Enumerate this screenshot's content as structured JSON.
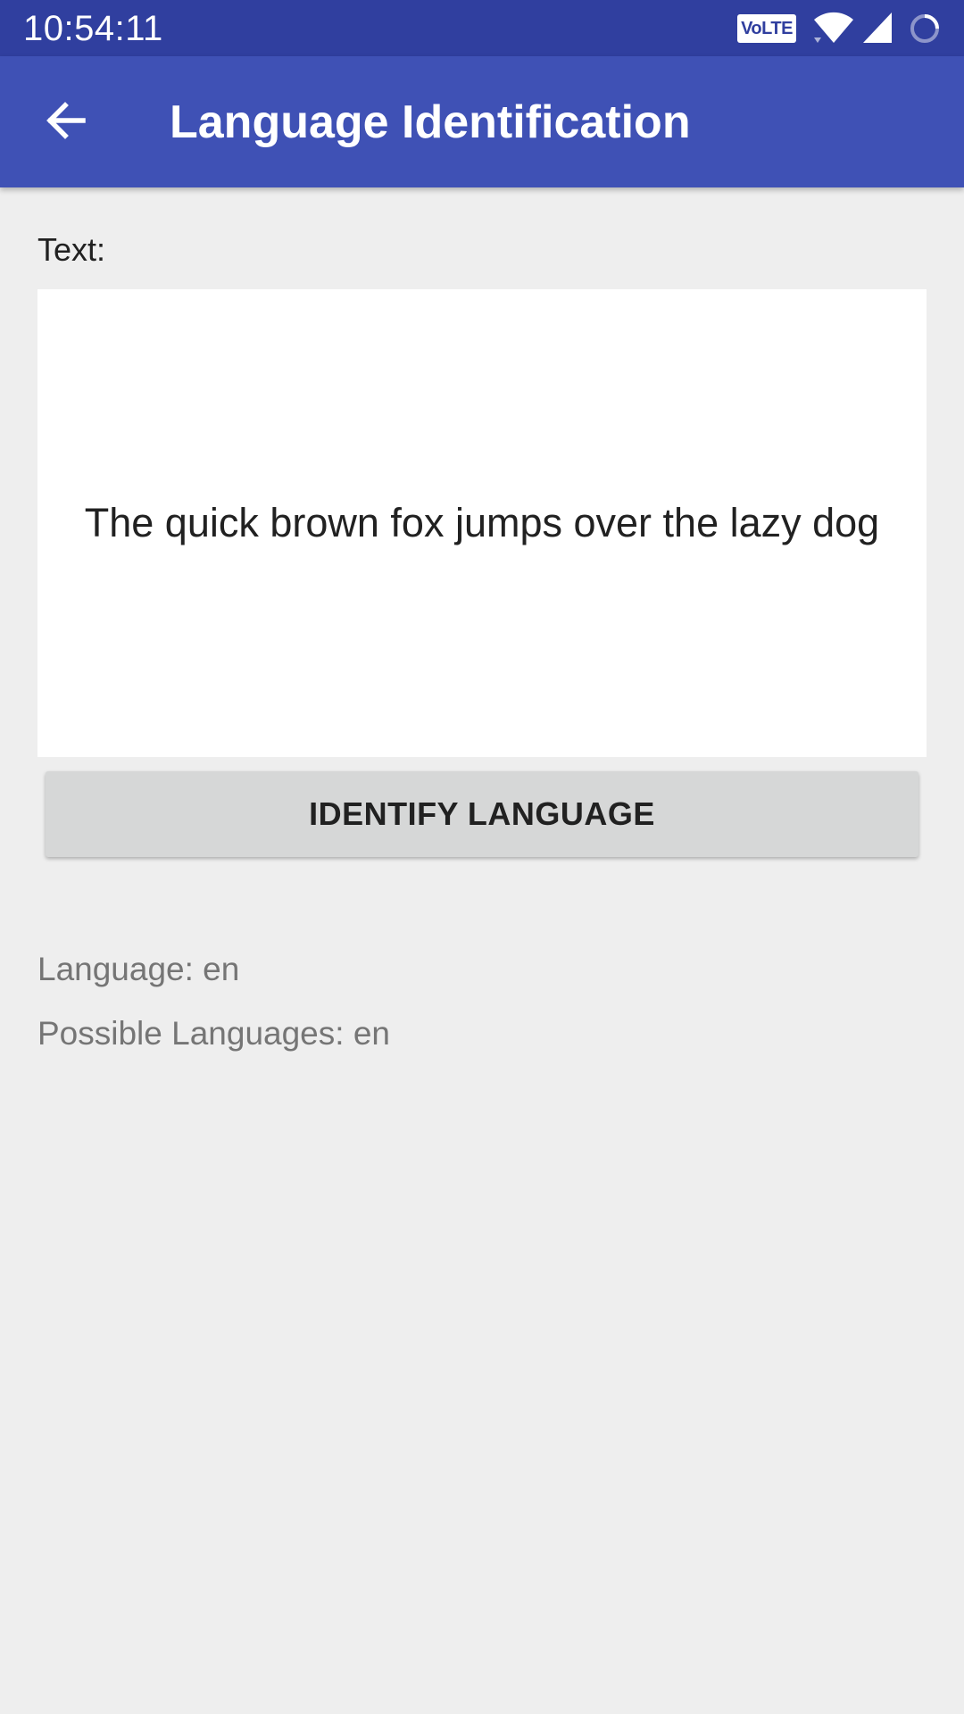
{
  "status_bar": {
    "time": "10:54:11",
    "volte_label": "VoLTE"
  },
  "app_bar": {
    "title": "Language Identification"
  },
  "form": {
    "text_label": "Text:",
    "text_value": "The quick brown fox jumps over the lazy dog",
    "button_label": "IDENTIFY LANGUAGE"
  },
  "results": {
    "language": "Language: en",
    "possible_languages": "Possible Languages: en"
  },
  "colors": {
    "status_bar": "#303f9f",
    "app_bar": "#3f51b5",
    "background": "#eeeeee",
    "button": "#d6d7d7"
  },
  "icons": {
    "back": "arrow-back-icon",
    "wifi": "wifi-icon",
    "signal": "signal-icon",
    "battery": "battery-ring-icon"
  }
}
